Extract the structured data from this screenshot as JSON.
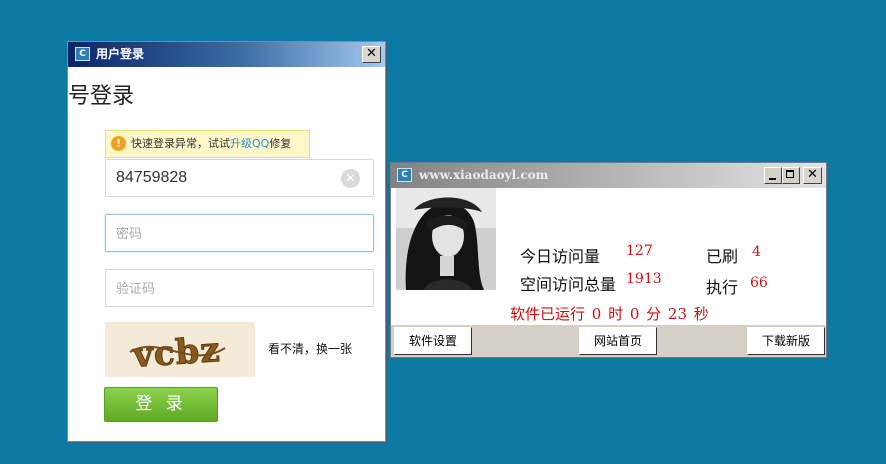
{
  "login_window": {
    "title": "用户登录",
    "icon": "app-icon",
    "heading": "号登录",
    "warning": {
      "prefix": "快速登录异常，试试",
      "link": "升级QQ",
      "suffix": "修复",
      "icon": "exclamation-icon"
    },
    "account": {
      "value": "84759828",
      "placeholder": ""
    },
    "password": {
      "value": "",
      "placeholder": "密码"
    },
    "captcha": {
      "value": "",
      "placeholder": "验证码",
      "image_text": "vcbz"
    },
    "refresh_text": "看不清，换一张",
    "login_button": "登 录",
    "close_label": "✕"
  },
  "app_window": {
    "title": "www.xiaodaoyl.com",
    "stats": {
      "today_visits_label": "今日访问量",
      "today_visits_value": "127",
      "total_visits_label": "空间访问总量",
      "total_visits_value": "1913",
      "refreshed_label": "已刷",
      "refreshed_value": "4",
      "executed_label": "执行",
      "executed_value": "66"
    },
    "running_text": "软件已运行 0 时 0 分 23 秒",
    "buttons": {
      "settings": "软件设置",
      "homepage": "网站首页",
      "download": "下载新版"
    }
  },
  "colors": {
    "desktop": "#0a7aa3",
    "value_red": "#d01010",
    "login_green": "#6db82e",
    "link_blue": "#2a8fd8"
  }
}
